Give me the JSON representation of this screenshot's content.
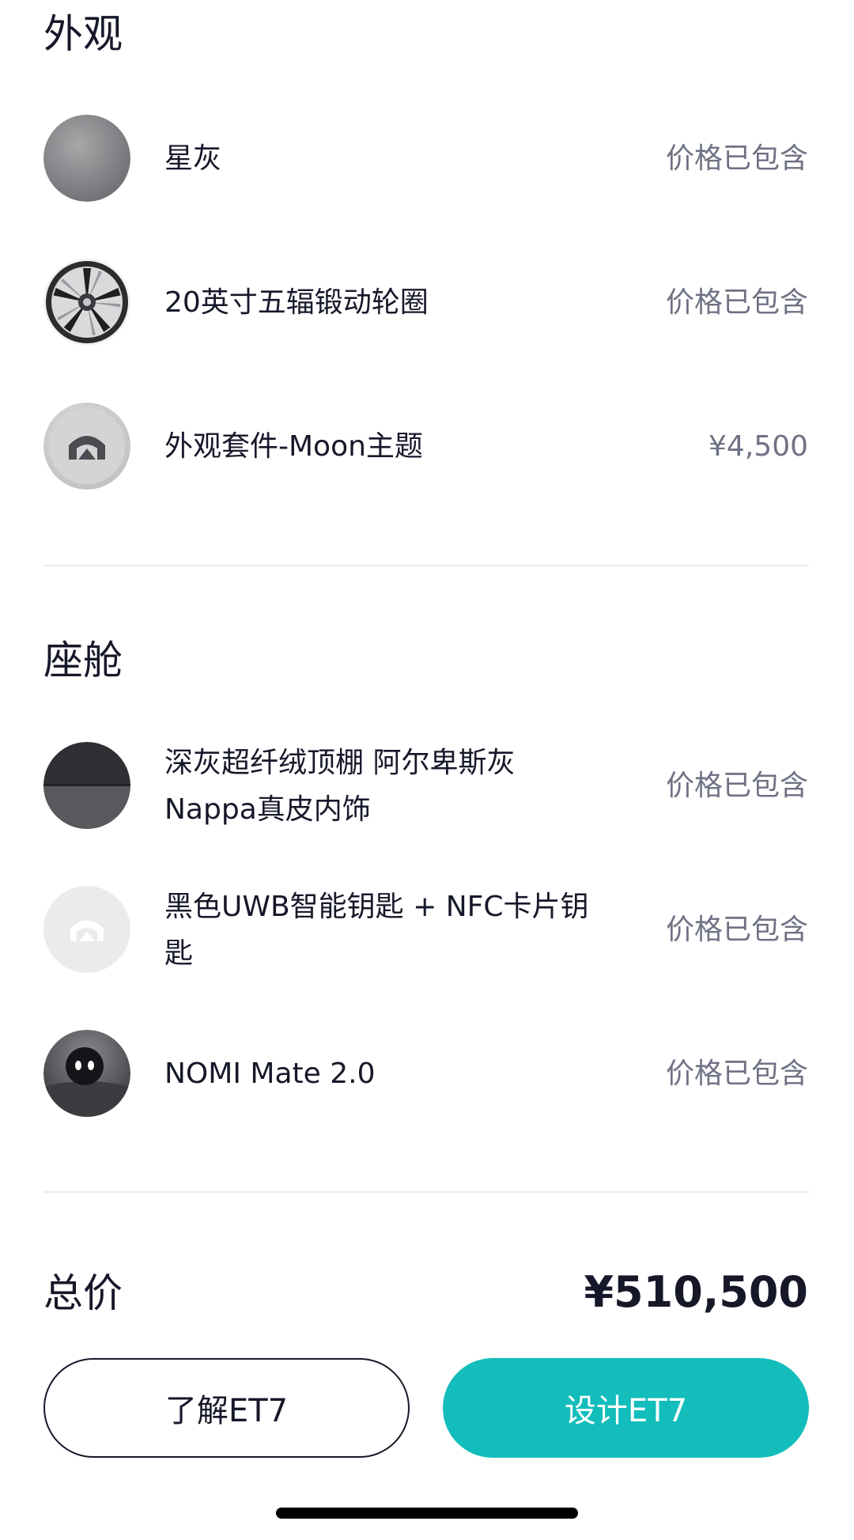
{
  "exterior": {
    "title": "外观",
    "items": [
      {
        "label": "星灰",
        "price": "价格已包含",
        "icon": "star-gray-swatch-icon"
      },
      {
        "label": "20英寸五辐锻动轮圈",
        "price": "价格已包含",
        "icon": "wheel-icon"
      },
      {
        "label": "外观套件-Moon主题",
        "price": "¥4,500",
        "icon": "moon-theme-icon"
      }
    ]
  },
  "cabin": {
    "title": "座舱",
    "items": [
      {
        "label": "深灰超纤绒顶棚 阿尔卑斯灰 Nappa真皮内饰",
        "price": "价格已包含",
        "icon": "interior-swatch-icon"
      },
      {
        "label": "黑色UWB智能钥匙 + NFC卡片钥匙",
        "price": "价格已包含",
        "icon": "smart-key-icon"
      },
      {
        "label": "NOMI Mate 2.0",
        "price": "价格已包含",
        "icon": "nomi-icon"
      }
    ]
  },
  "total": {
    "label": "总价",
    "value": "¥510,500"
  },
  "actions": {
    "learn_label": "了解ET7",
    "design_label": "设计ET7"
  },
  "colors": {
    "accent": "#12bdbb",
    "text": "#16182a",
    "muted": "#6f7284",
    "divider": "#e8eaef"
  }
}
